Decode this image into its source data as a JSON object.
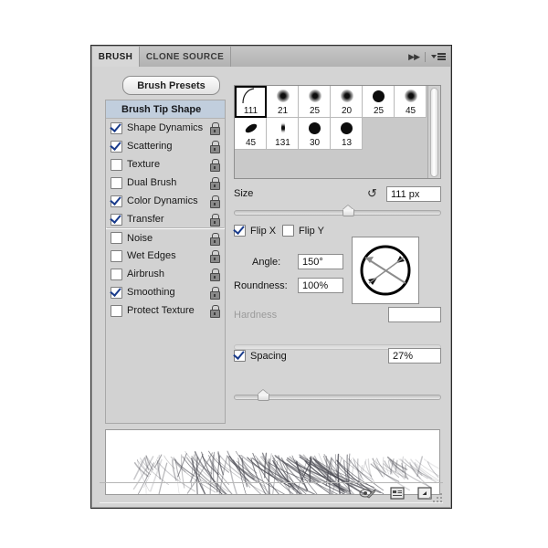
{
  "app": {
    "panel_title": "Brush Panel"
  },
  "tabs": [
    {
      "label": "BRUSH",
      "active": true
    },
    {
      "label": "CLONE SOURCE",
      "active": false
    }
  ],
  "header_icons": {
    "collapse": "collapse-chevrons-icon",
    "menu": "panel-menu-icon"
  },
  "toolbar": {
    "brush_presets_label": "Brush Presets"
  },
  "sidebar": {
    "header": "Brush Tip Shape",
    "items": [
      {
        "label": "Shape Dynamics",
        "checked": true,
        "locked": true,
        "separator": false
      },
      {
        "label": "Scattering",
        "checked": true,
        "locked": true,
        "separator": false
      },
      {
        "label": "Texture",
        "checked": false,
        "locked": true,
        "separator": false
      },
      {
        "label": "Dual Brush",
        "checked": false,
        "locked": true,
        "separator": false
      },
      {
        "label": "Color Dynamics",
        "checked": true,
        "locked": true,
        "separator": false
      },
      {
        "label": "Transfer",
        "checked": true,
        "locked": true,
        "separator": false
      },
      {
        "label": "Noise",
        "checked": false,
        "locked": true,
        "separator": true
      },
      {
        "label": "Wet Edges",
        "checked": false,
        "locked": true,
        "separator": false
      },
      {
        "label": "Airbrush",
        "checked": false,
        "locked": true,
        "separator": false
      },
      {
        "label": "Smoothing",
        "checked": true,
        "locked": true,
        "separator": false
      },
      {
        "label": "Protect Texture",
        "checked": false,
        "locked": true,
        "separator": false
      }
    ]
  },
  "presets": {
    "rows": [
      [
        {
          "size": "111",
          "kind": "stroke",
          "selected": true
        },
        {
          "size": "21",
          "kind": "soft",
          "selected": false
        },
        {
          "size": "25",
          "kind": "soft",
          "selected": false
        },
        {
          "size": "20",
          "kind": "soft",
          "selected": false
        },
        {
          "size": "25",
          "kind": "hard",
          "selected": false
        },
        {
          "size": "45",
          "kind": "soft",
          "selected": false
        }
      ],
      [
        {
          "size": "45",
          "kind": "slant",
          "selected": false
        },
        {
          "size": "131",
          "kind": "thin",
          "selected": false
        },
        {
          "size": "30",
          "kind": "hard",
          "selected": false
        },
        {
          "size": "13",
          "kind": "hard",
          "selected": false
        }
      ]
    ]
  },
  "controls": {
    "size": {
      "label": "Size",
      "value": "111 px",
      "reset_icon": "reset-size-icon",
      "slider_percent": 55
    },
    "flip_x": {
      "label": "Flip X",
      "checked": true
    },
    "flip_y": {
      "label": "Flip Y",
      "checked": false
    },
    "angle": {
      "label": "Angle:",
      "value": "150°"
    },
    "roundness": {
      "label": "Roundness:",
      "value": "100%"
    },
    "hardness": {
      "label": "Hardness",
      "value": "",
      "disabled": true,
      "slider_percent": 0
    },
    "spacing": {
      "label": "Spacing",
      "checked": true,
      "value": "27%",
      "slider_percent": 14
    },
    "angle_preview": {
      "name": "angle-roundness-preview",
      "angle_deg": 150
    }
  },
  "preview": {
    "name": "brush-stroke-preview"
  },
  "footer": {
    "icons": [
      {
        "name": "toggle-live-tip-brush-preview-icon"
      },
      {
        "name": "open-preset-manager-icon"
      },
      {
        "name": "create-new-brush-icon"
      }
    ],
    "resize_grip": "resize-grip"
  },
  "colors": {
    "panel_bg": "#d4d4d4",
    "sidebar_header_bg": "#c1cedd",
    "check_color": "#1a3c8c",
    "field_bg": "#ffffff",
    "border": "#8c8c8c"
  }
}
